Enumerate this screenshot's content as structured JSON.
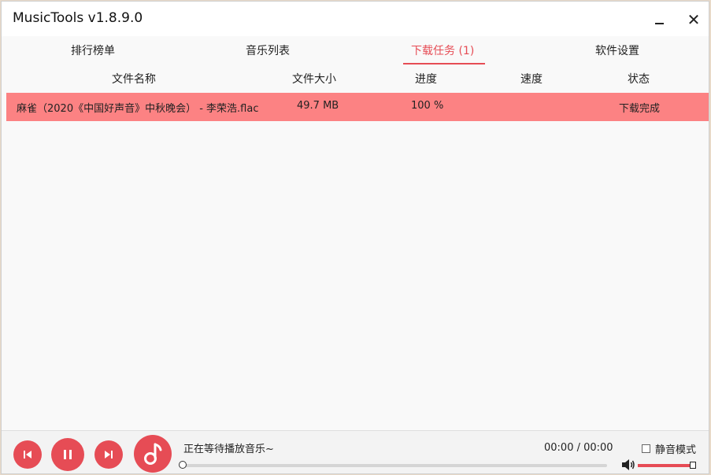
{
  "window": {
    "title": "MusicTools v1.8.9.0",
    "minimize_icon": "minimize-icon",
    "close_icon": "close-icon",
    "close_glyph": "✕"
  },
  "tabs": [
    {
      "label": "排行榜单",
      "active": false
    },
    {
      "label": "音乐列表",
      "active": false
    },
    {
      "label": "下载任务 (1)",
      "active": true
    },
    {
      "label": "软件设置",
      "active": false
    }
  ],
  "table": {
    "columns": [
      "文件名称",
      "文件大小",
      "进度",
      "速度",
      "状态"
    ],
    "rows": [
      {
        "name": "麻雀（2020《中国好声音》中秋晚会） - 李荣浩.flac",
        "size": "49.7 MB",
        "progress": "100 %",
        "speed": "",
        "status": "下载完成"
      }
    ]
  },
  "player": {
    "now_playing": "正在等待播放音乐~",
    "time": "00:00 / 00:00",
    "progress_fraction": 0,
    "mute_label": "静音模式",
    "mute_checked": false,
    "volume_fraction": 1.0,
    "icons": [
      "previous-icon",
      "pause-icon",
      "next-icon",
      "music-note-icon",
      "speaker-icon"
    ]
  },
  "colors": {
    "accent": "#e64c55",
    "row_highlight": "#fc8283"
  }
}
